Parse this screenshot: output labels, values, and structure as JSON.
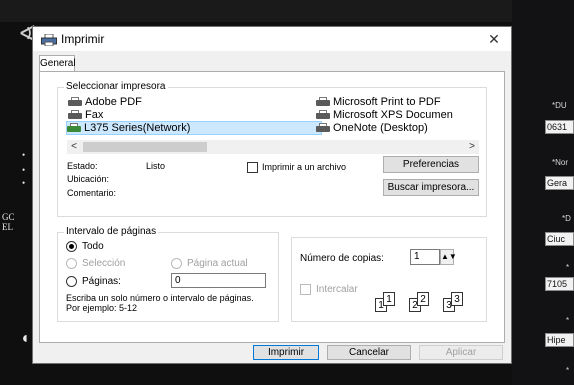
{
  "background": {
    "right_labels": [
      "*DU",
      "*Nor",
      "*D",
      "*",
      "*",
      "*"
    ],
    "right_fields": [
      "0631",
      "Gera",
      "Ciuc",
      "7105",
      "Hipe"
    ],
    "left_text_1": "GC",
    "left_text_2": "EL"
  },
  "dialog": {
    "title": "Imprimir",
    "close_glyph": "✕",
    "tab": "General"
  },
  "printer_select": {
    "group_label": "Seleccionar impresora",
    "printers": [
      {
        "name": "Adobe PDF",
        "selected": false
      },
      {
        "name": "Fax",
        "selected": false
      },
      {
        "name": "L375 Series(Network)",
        "selected": true
      },
      {
        "name": "Microsoft Print to PDF",
        "selected": false
      },
      {
        "name": "Microsoft XPS Documen",
        "selected": false
      },
      {
        "name": "OneNote (Desktop)",
        "selected": false
      }
    ],
    "scroll_left": "<",
    "scroll_right": ">",
    "status_label": "Estado:",
    "status_value": "Listo",
    "location_label": "Ubicación:",
    "comment_label": "Comentario:",
    "print_to_file_label": "Imprimir a un archivo",
    "preferences_button": "Preferencias",
    "find_printer_button": "Buscar impresora..."
  },
  "page_range": {
    "group_label": "Intervalo de páginas",
    "all_label": "Todo",
    "selection_label": "Selección",
    "current_page_label": "Página actual",
    "pages_label": "Páginas:",
    "pages_value": "0",
    "hint": "Escriba un solo número o intervalo de páginas. Por ejemplo: 5-12"
  },
  "copies": {
    "copies_label": "Número de copias:",
    "copies_value": "1",
    "collate_label": "Intercalar",
    "collate_pages": [
      "1",
      "1",
      "2",
      "2",
      "3",
      "3"
    ]
  },
  "footer": {
    "print_button": "Imprimir",
    "cancel_button": "Cancelar",
    "apply_button": "Aplicar"
  }
}
